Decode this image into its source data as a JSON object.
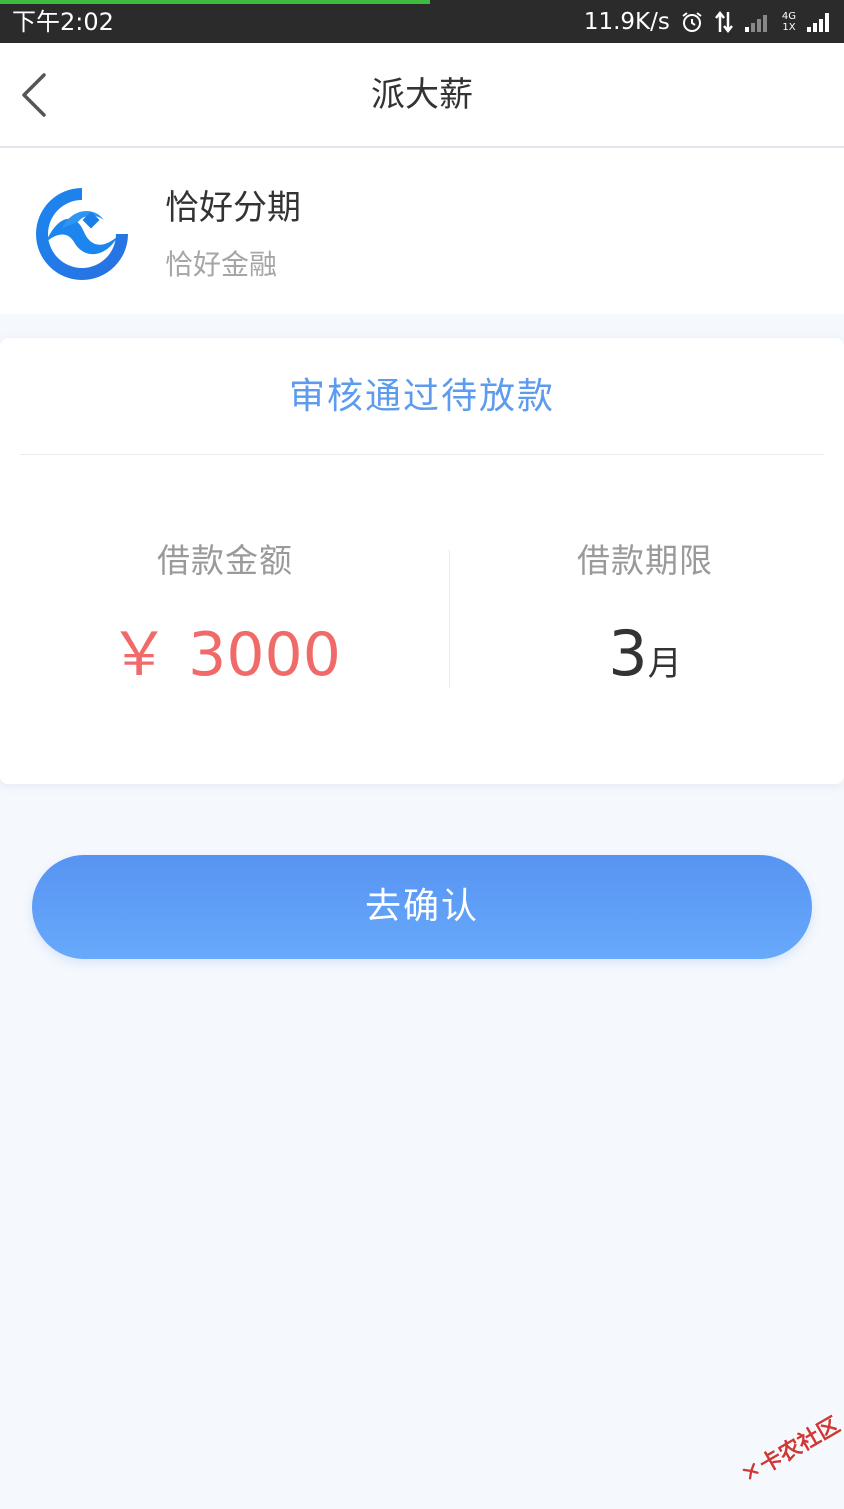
{
  "status_bar": {
    "time": "下午2:02",
    "speed": "11.9K/s",
    "network_top": "4G",
    "network_bottom": "1X"
  },
  "nav": {
    "title": "派大薪",
    "back_icon": "chevron-left-icon"
  },
  "product": {
    "name": "恰好分期",
    "company": "恰好金融",
    "logo_icon": "qiahao-logo-icon"
  },
  "loan": {
    "status": "审核通过待放款",
    "amount_label": "借款金额",
    "amount_value": "￥ 3000",
    "term_label": "借款期限",
    "term_number": "3",
    "term_unit": "月"
  },
  "actions": {
    "confirm_label": "去确认"
  },
  "watermark": {
    "text": "卡农社区"
  },
  "colors": {
    "accent_blue": "#5c9bee",
    "amount_red": "#f06a6a",
    "button_gradient_top": "#5794f2",
    "button_gradient_bottom": "#67a9fb",
    "background": "#f5f8fd"
  }
}
